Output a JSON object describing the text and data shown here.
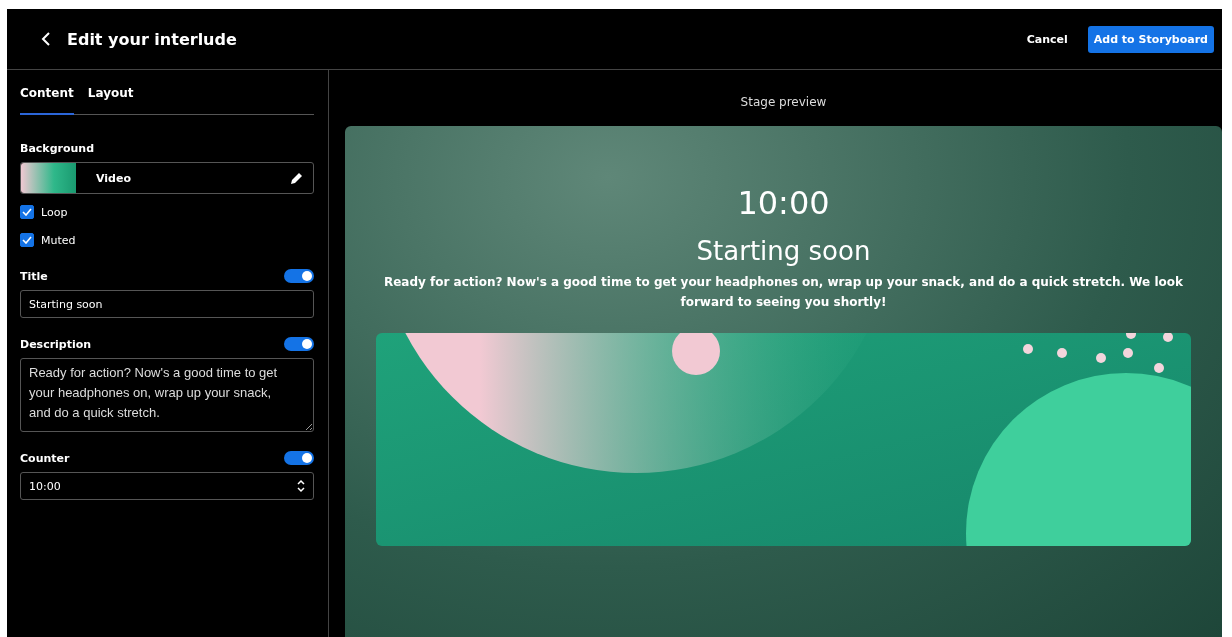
{
  "header": {
    "title": "Edit your interlude",
    "buttons": [
      {
        "label": "Cancel",
        "kind": "text"
      },
      {
        "label": "Add to Storyboard",
        "kind": "primary"
      }
    ]
  },
  "tabs": [
    {
      "label": "Content",
      "selected": true
    },
    {
      "label": "Layout",
      "selected": false
    }
  ],
  "background": {
    "label": "Background",
    "value": "Video",
    "options": [
      {
        "label": "Loop",
        "checked": true
      },
      {
        "label": "Muted",
        "checked": true
      }
    ]
  },
  "title_field": {
    "label": "Title",
    "on": true,
    "value": "Starting soon"
  },
  "description_field": {
    "label": "Description",
    "on": true,
    "value": "Ready for action? Now's a good time to get your headphones on, wrap up your snack, and do a quick stretch."
  },
  "counter_field": {
    "label": "Counter",
    "on": true,
    "value": "10:00"
  },
  "preview": {
    "heading": "Stage preview",
    "counter": "10:00",
    "title": "Starting soon",
    "description": "Ready for action? Now's a good time to get your headphones on, wrap up your snack, and do a quick stretch. We look forward to seeing you shortly!"
  }
}
